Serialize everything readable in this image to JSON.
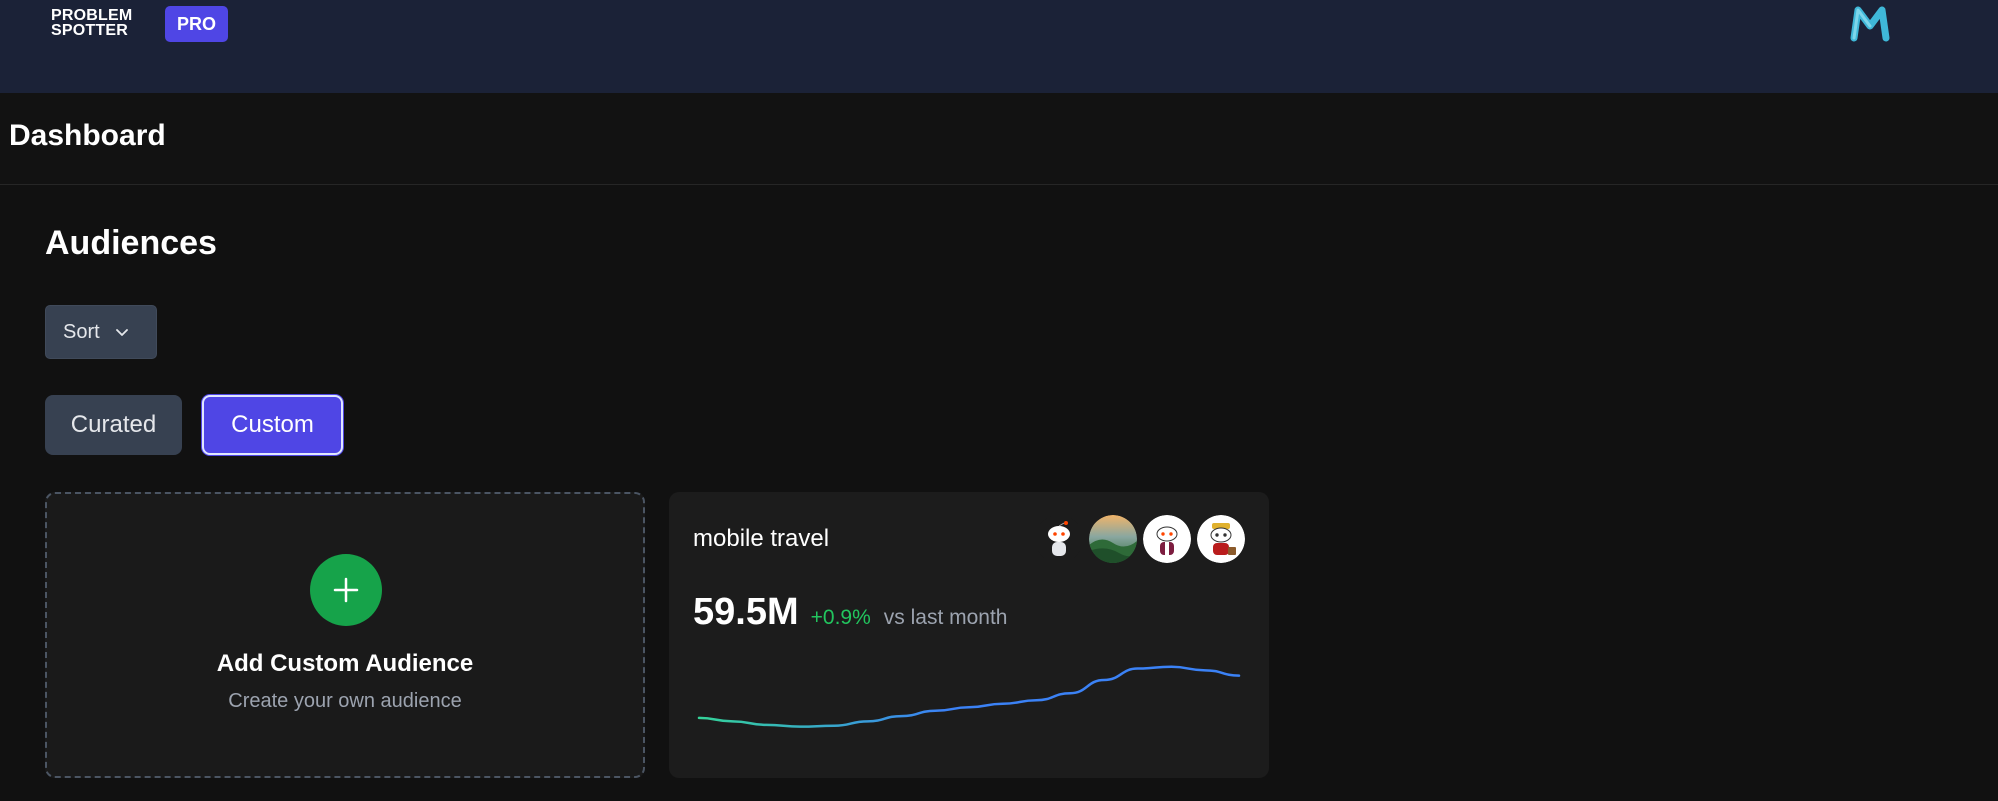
{
  "header": {
    "logo_line1": "PROBLEM",
    "logo_line2": "SPOTTER",
    "badge": "PRO",
    "brand_mark": "M-logo-icon"
  },
  "page": {
    "title": "Dashboard"
  },
  "audiences": {
    "title": "Audiences",
    "sort_label": "Sort",
    "tabs": [
      {
        "label": "Curated",
        "active": false
      },
      {
        "label": "Custom",
        "active": true
      }
    ],
    "add_card": {
      "title": "Add Custom Audience",
      "subtitle": "Create your own audience"
    },
    "cards": [
      {
        "name": "mobile travel",
        "value": "59.5M",
        "change": "+0.9%",
        "change_label": "vs last month",
        "avatars": [
          "snoo-avatar-icon",
          "landscape-avatar",
          "snoo-avatar-icon",
          "snoo-avatar-icon"
        ],
        "trend": [
          0.32,
          0.28,
          0.24,
          0.22,
          0.23,
          0.28,
          0.34,
          0.4,
          0.44,
          0.48,
          0.52,
          0.6,
          0.75,
          0.88,
          0.9,
          0.86,
          0.8
        ]
      }
    ]
  },
  "colors": {
    "accent": "#4f46e5",
    "positive": "#22c55e",
    "add_button": "#16a34a",
    "spark_start": "#34d399",
    "spark_end": "#3b82f6"
  }
}
